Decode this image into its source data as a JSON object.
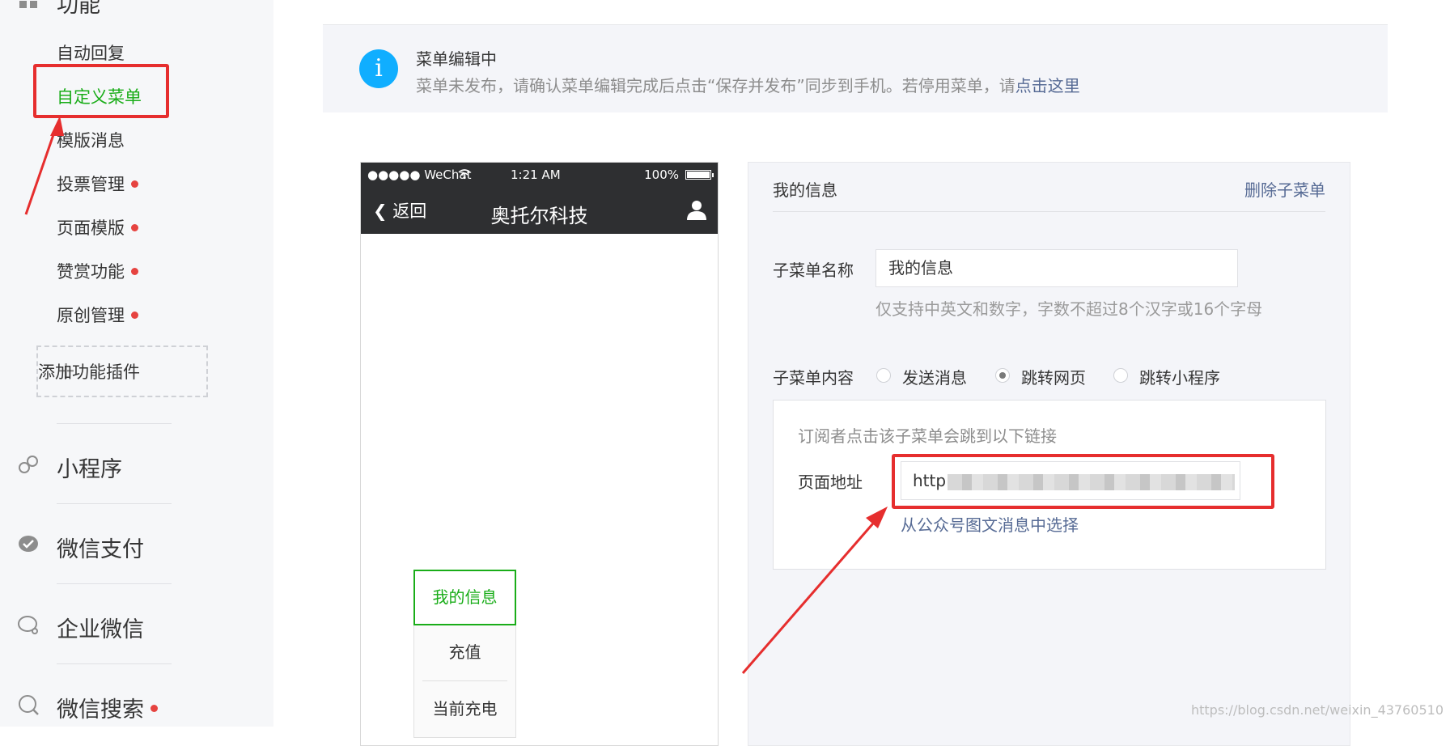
{
  "sidebar": {
    "section_title": "功能",
    "items": [
      {
        "label": "自动回复",
        "dot": false
      },
      {
        "label": "自定义菜单",
        "dot": false,
        "active": true
      },
      {
        "label": "模版消息",
        "dot": false
      },
      {
        "label": "投票管理",
        "dot": true
      },
      {
        "label": "页面模版",
        "dot": true
      },
      {
        "label": "赞赏功能",
        "dot": true
      },
      {
        "label": "原创管理",
        "dot": true
      }
    ],
    "add_plugin": "添加功能插件",
    "groups": [
      {
        "label": "小程序",
        "icon": "mini-program-icon"
      },
      {
        "label": "微信支付",
        "icon": "wechat-pay-icon"
      },
      {
        "label": "企业微信",
        "icon": "work-wechat-icon"
      },
      {
        "label": "微信搜索",
        "icon": "wechat-search-icon",
        "dot": true
      }
    ]
  },
  "notice": {
    "title": "菜单编辑中",
    "desc_prefix": "菜单未发布，请确认菜单编辑完成后点击“保存并发布”同步到手机。若停用菜单，请",
    "desc_link": "点击这里"
  },
  "phone": {
    "status_carrier": "●●●●● WeChat",
    "status_time": "1:21 AM",
    "status_battery": "100%",
    "back_label": "返回",
    "account_title": "奥托尔科技",
    "submenu": [
      "我的信息",
      "充值",
      "当前充电"
    ]
  },
  "editor": {
    "header_title": "我的信息",
    "delete_label": "删除子菜单",
    "name_label": "子菜单名称",
    "name_value": "我的信息",
    "name_hint": "仅支持中英文和数字，字数不超过8个汉字或16个字母",
    "content_label": "子菜单内容",
    "options": [
      "发送消息",
      "跳转网页",
      "跳转小程序"
    ],
    "selected_option": "跳转网页",
    "url_hint": "订阅者点击该子菜单会跳到以下链接",
    "url_label": "页面地址",
    "url_value": "http",
    "choose_link": "从公众号图文消息中选择"
  },
  "watermark": "https://blog.csdn.net/weixin_43760510",
  "colors": {
    "accent_green": "#1aad19",
    "link_blue": "#576b95",
    "info_blue": "#10aeff",
    "annotation_red": "#e62e2e",
    "badge_red": "#e64340"
  }
}
